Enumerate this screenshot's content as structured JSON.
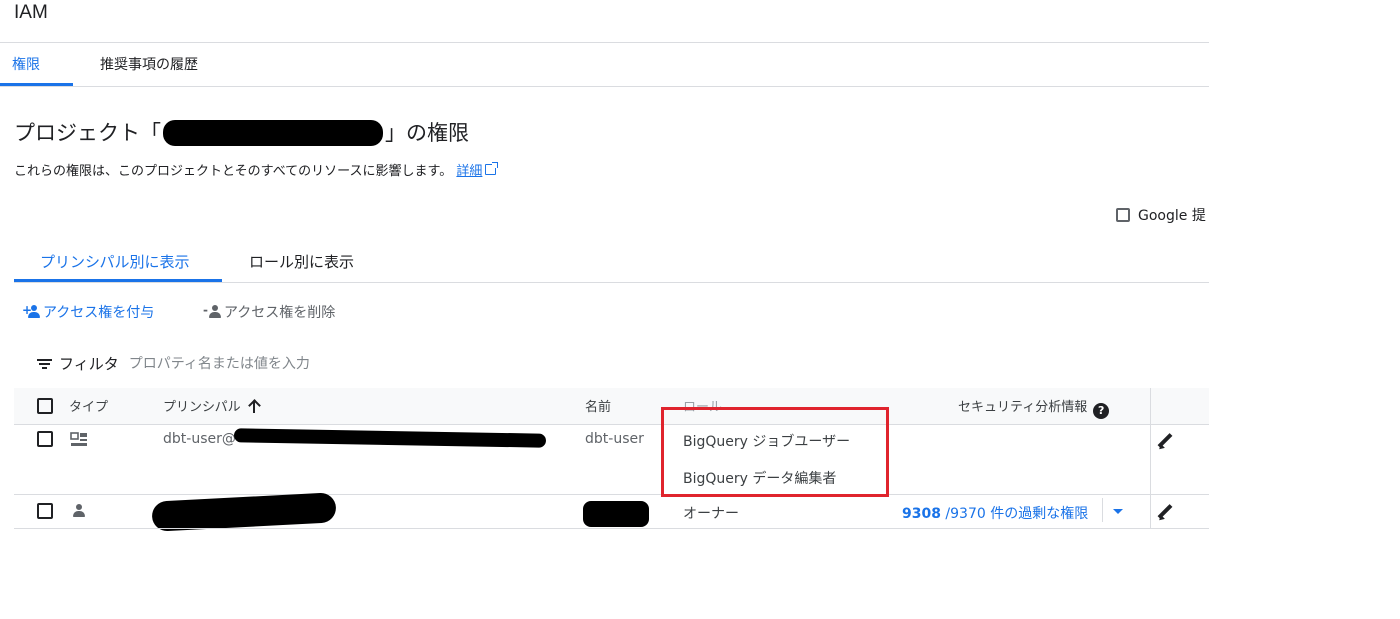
{
  "app": {
    "title": "IAM"
  },
  "top_tabs": [
    {
      "label": "権限",
      "active": true
    },
    {
      "label": "推奨事項の履歴",
      "active": false
    }
  ],
  "page": {
    "title_prefix": "プロジェクト「",
    "title_suffix": "」の権限",
    "subtitle": "これらの権限は、このプロジェクトとそのすべてのリソースに影響します。",
    "learn_more": "詳細"
  },
  "google_checkbox_label": "Google 提",
  "view_tabs": [
    {
      "label": "プリンシパル別に表示",
      "active": true
    },
    {
      "label": "ロール別に表示",
      "active": false
    }
  ],
  "actions": {
    "grant": "アクセス権を付与",
    "remove": "アクセス権を削除"
  },
  "filter": {
    "label": "フィルタ",
    "placeholder": "プロパティ名または値を入力"
  },
  "table": {
    "headers": {
      "type": "タイプ",
      "principal": "プリンシパル",
      "name": "名前",
      "role": "ロール",
      "security": "セキュリティ分析情報"
    },
    "rows": [
      {
        "type_icon": "service-account-icon",
        "principal": "dbt-user@",
        "name": "dbt-user",
        "roles": [
          "BigQuery ジョブユーザー",
          "BigQuery データ編集者"
        ]
      },
      {
        "type_icon": "person-icon",
        "roles": [
          "オーナー"
        ],
        "insight_count": "9308",
        "insight_rest": " /9370 件の過剰な権限"
      }
    ]
  },
  "colors": {
    "accent": "#1a73e8",
    "highlight": "#e0242d",
    "divider": "#dadce0",
    "header_bg": "#f8f9fa"
  }
}
